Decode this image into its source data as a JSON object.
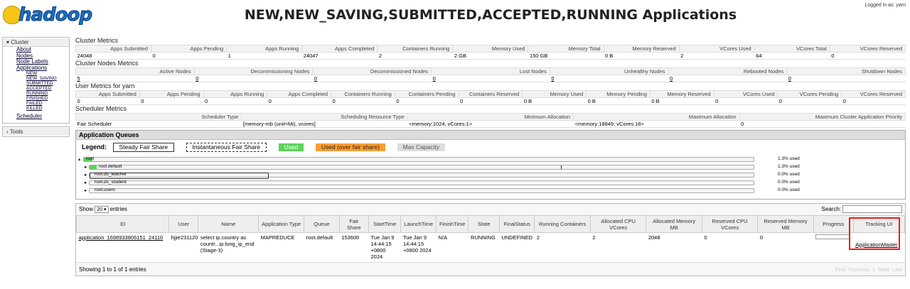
{
  "header": {
    "logo_text": "hadoop",
    "title": "NEW,NEW_SAVING,SUBMITTED,ACCEPTED,RUNNING Applications",
    "logged_in": "Logged in as: yarn"
  },
  "sidebar": {
    "cluster": "▾ Cluster",
    "links": [
      "About",
      "Nodes",
      "Node Labels",
      "Applications"
    ],
    "states": [
      "NEW",
      "NEW_SAVING",
      "SUBMITTED",
      "ACCEPTED",
      "RUNNING",
      "FINISHED",
      "FAILED",
      "KILLED"
    ],
    "scheduler": "Scheduler",
    "tools": "› Tools"
  },
  "cluster_metrics": {
    "title": "Cluster Metrics",
    "headers": [
      "Apps Submitted",
      "Apps Pending",
      "Apps Running",
      "Apps Completed",
      "Containers Running",
      "Memory Used",
      "Memory Total",
      "Memory Reserved",
      "VCores Used",
      "VCores Total",
      "VCores Reserved"
    ],
    "values": [
      "24048",
      "0",
      "1",
      "24047",
      "2",
      "2 GB",
      "150 GB",
      "0 B",
      "2",
      "64",
      "0"
    ]
  },
  "node_metrics": {
    "title": "Cluster Nodes Metrics",
    "headers": [
      "Active Nodes",
      "Decommissioning Nodes",
      "Decommissioned Nodes",
      "Lost Nodes",
      "Unhealthy Nodes",
      "Rebooted Nodes",
      "Shutdown Nodes"
    ],
    "values": [
      "5",
      "0",
      "0",
      "0",
      "0",
      "0",
      "0"
    ]
  },
  "user_metrics": {
    "title": "User Metrics for yarn",
    "headers": [
      "Apps Submitted",
      "Apps Pending",
      "Apps Running",
      "Apps Completed",
      "Containers Running",
      "Containers Pending",
      "Containers Reserved",
      "Memory Used",
      "Memory Pending",
      "Memory Reserved",
      "VCores Used",
      "VCores Pending",
      "VCores Reserved"
    ],
    "values": [
      "0",
      "0",
      "0",
      "0",
      "0",
      "0",
      "0",
      "0 B",
      "0 B",
      "0 B",
      "0",
      "0",
      "0"
    ]
  },
  "scheduler_metrics": {
    "title": "Scheduler Metrics",
    "headers": [
      "Scheduler Type",
      "Scheduling Resource Type",
      "Minimum Allocation",
      "Maximum Allocation",
      "Maximum Cluster Application Priority"
    ],
    "values": [
      "Fair Scheduler",
      "[memory-mb (unit=Mi), vcores]",
      "<memory:1024, vCores:1>",
      "<memory:18849, vCores:16>",
      "0"
    ]
  },
  "queues": {
    "title": "Application Queues",
    "legend_label": "Legend:",
    "legend": [
      "Steady Fair Share",
      "Instantaneous Fair Share",
      "Used",
      "Used (over fair share)",
      "Max Capacity"
    ],
    "colors": {
      "used": "#5cd35c",
      "over": "#f99e33",
      "max": "#ddd"
    },
    "rows": [
      {
        "name": "root",
        "pct": "1.3% used",
        "used": 0.013
      },
      {
        "name": "root.default",
        "pct": "1.3% used",
        "used": 0.013
      },
      {
        "name": "root.ds_teacher",
        "pct": "0.0% used",
        "used": 0
      },
      {
        "name": "root.ds_student",
        "pct": "0.0% used",
        "used": 0
      },
      {
        "name": "root.users",
        "pct": "0.0% used",
        "used": 0
      }
    ]
  },
  "apps": {
    "show": "Show",
    "show_value": "20",
    "entries": "entries",
    "search": "Search:",
    "headers": [
      "ID",
      "User",
      "Name",
      "Application Type",
      "Queue",
      "Fair Share",
      "StartTime",
      "LaunchTime",
      "FinishTime",
      "State",
      "FinalStatus",
      "Running Containers",
      "Allocated CPU VCores",
      "Allocated Memory MB",
      "Reserved CPU VCores",
      "Reserved Memory MB",
      "Progress",
      "Tracking UI"
    ],
    "row": {
      "id": "application_1698933806151_24110",
      "user": "hjjie231120",
      "name": "select ip.country as countr...ip.long_ip_end (Stage-3)",
      "type": "MAPREDUCE",
      "queue": "root.default",
      "fair": "153600",
      "start": "Tue Jan 9 14:44:15 +0800 2024",
      "launch": "Tue Jan 9 14:44:15 +0800 2024",
      "finish": "N/A",
      "state": "RUNNING",
      "final": "UNDEFINED",
      "running": "2",
      "alloc_cpu": "2",
      "alloc_mem": "2048",
      "res_cpu": "0",
      "res_mem": "0",
      "progress": 0,
      "tracking": "ApplicationMaster"
    },
    "showing": "Showing 1 to 1 of 1 entries",
    "pager": [
      "First",
      "Previous",
      "1",
      "Next",
      "Last"
    ]
  }
}
